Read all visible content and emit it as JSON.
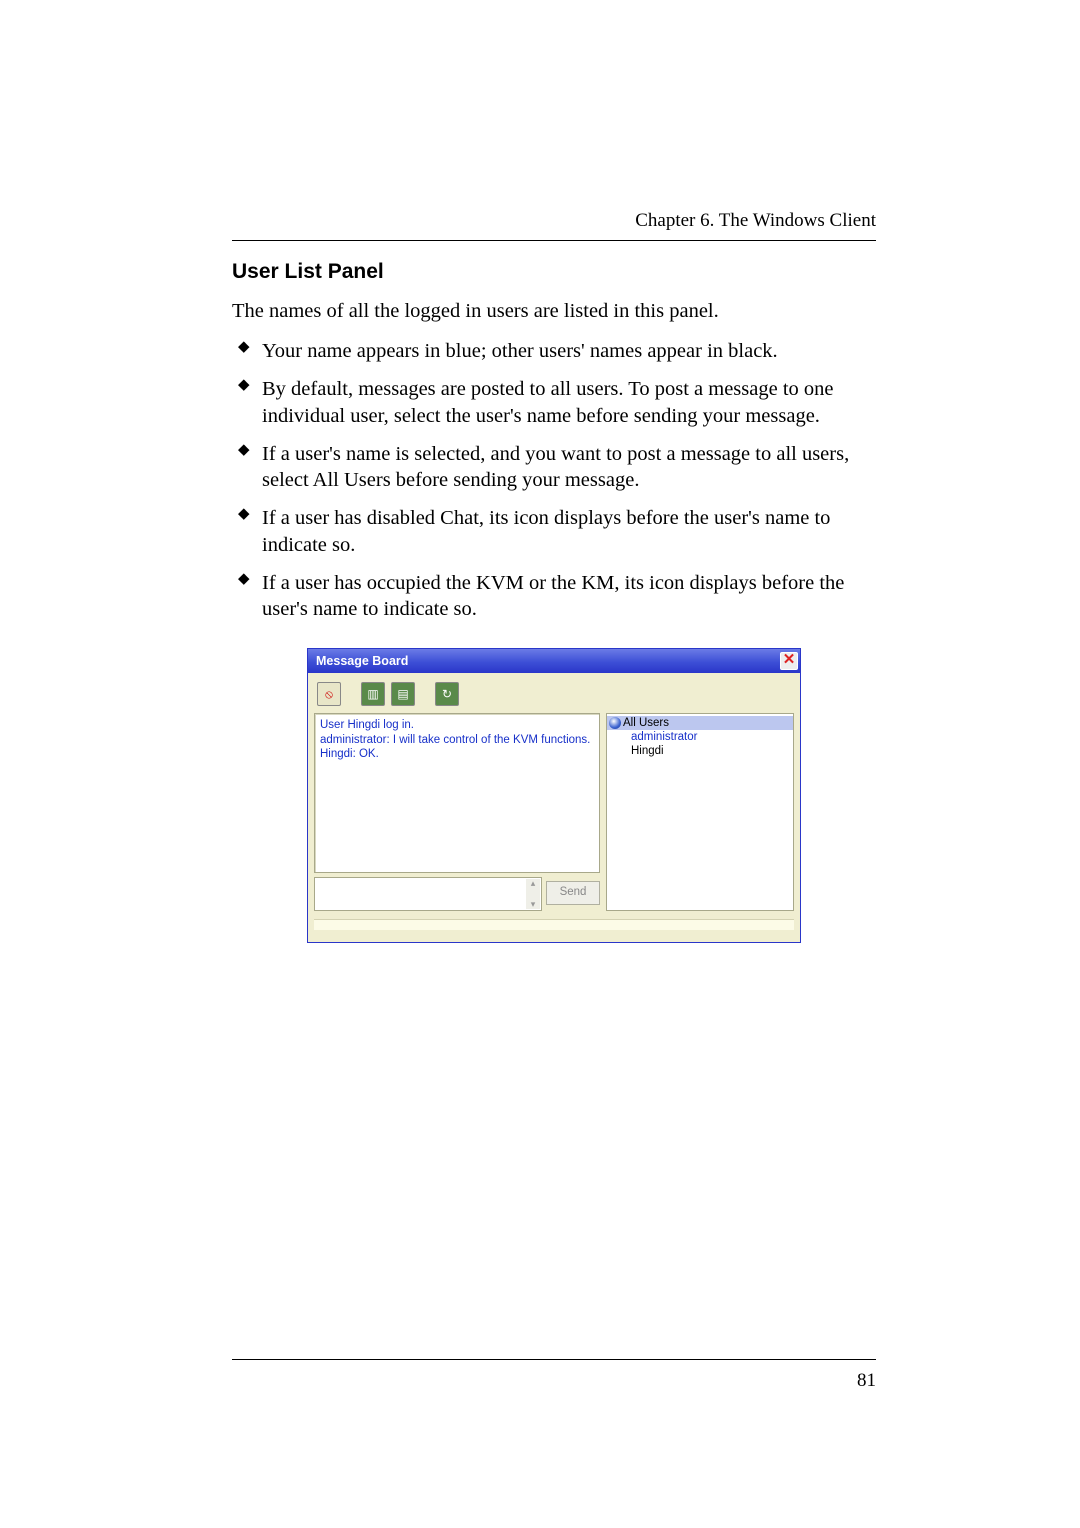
{
  "header": {
    "running": "Chapter 6. The Windows Client"
  },
  "section": {
    "title": "User List Panel"
  },
  "lead": "The names of all the logged in users are listed in this panel.",
  "bullets": [
    "Your name appears in blue; other users' names appear in black.",
    "By default, messages are posted to all users. To post a message to one individual user, select the user's name before sending your message.",
    "If a user's name is selected, and you want to post a message to all users, select All Users before sending your message.",
    "If a user has disabled Chat, its icon displays before the user's name to indicate so.",
    "If a user has occupied the KVM or the KM, its icon displays before the user's name to indicate so."
  ],
  "mb": {
    "title": "Message Board",
    "close_glyph": "✕",
    "toolbar_icons": [
      "chat-disable-icon",
      "occupy-kvm-icon",
      "occupy-km-icon",
      "refresh-icon"
    ],
    "log_lines": [
      "User Hingdi log in.",
      "administrator: I will take control of the KVM functions.",
      "Hingdi: OK."
    ],
    "send_label": "Send",
    "users": {
      "all_label": "All Users",
      "list": [
        {
          "name": "administrator",
          "self": true
        },
        {
          "name": "Hingdi",
          "self": false
        }
      ]
    }
  },
  "page_number": "81"
}
